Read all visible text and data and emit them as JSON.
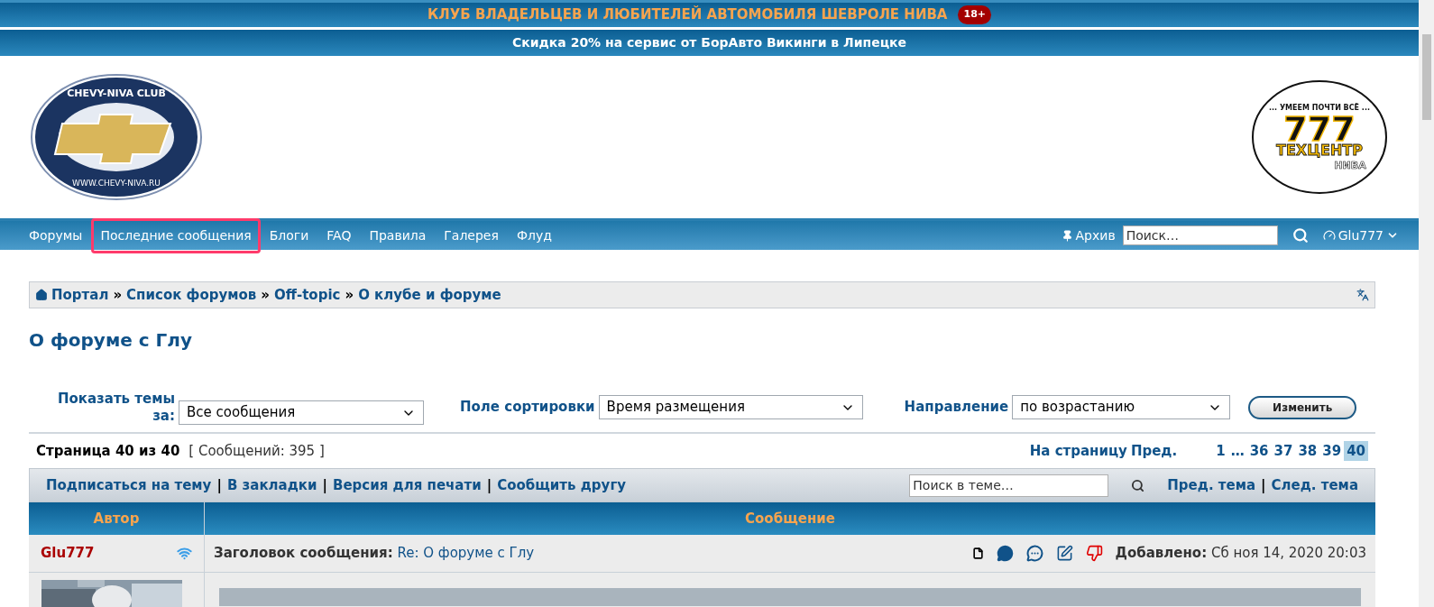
{
  "top_banner": {
    "title": "КЛУБ ВЛАДЕЛЬЦЕВ И ЛЮБИТЕЛЕЙ АВТОМОБИЛЯ ШЕВРОЛЕ НИВА",
    "badge": "18+"
  },
  "promo_banner": {
    "text": "Скидка 20% на сервис от БорАвто Викинги в Липецке"
  },
  "header": {
    "logo_left": {
      "top_text": "CHEVY-NIVA CLUB",
      "bottom_text": "WWW.CHEVY-NIVA.RU"
    },
    "logo_right": {
      "tagline": "... УМЕЕМ ПОЧТИ ВСЁ ...",
      "number": "777",
      "name": "ТЕХЦЕНТР",
      "sub": "НИВА"
    }
  },
  "nav": {
    "items": [
      {
        "label": "Форумы",
        "highlighted": false
      },
      {
        "label": "Последние сообщения",
        "highlighted": true
      },
      {
        "label": "Блоги",
        "highlighted": false
      },
      {
        "label": "FAQ",
        "highlighted": false
      },
      {
        "label": "Правила",
        "highlighted": false
      },
      {
        "label": "Галерея",
        "highlighted": false
      },
      {
        "label": "Флуд",
        "highlighted": false
      }
    ],
    "archive": "Архив",
    "search": {
      "placeholder": "Поиск…"
    },
    "user": "Glu777"
  },
  "breadcrumb": [
    {
      "label": "Портал"
    },
    {
      "separator": "»",
      "label": "Список форумов"
    },
    {
      "separator": "»",
      "label": "Off-topic"
    },
    {
      "separator": "»",
      "label": "О клубе и форуме"
    }
  ],
  "topic_title": "О форуме с Глу",
  "filters": [
    {
      "label": "Показать темы за:",
      "value": "Все сообщения"
    },
    {
      "label": "Поле сортировки",
      "value": "Время размещения"
    },
    {
      "label": "Направление",
      "value": "по возрастанию"
    }
  ],
  "submit": "Изменить",
  "page_info": {
    "page": "Страница 40 из 40",
    "count": "[ Сообщений: 395 ]"
  },
  "pagination": {
    "label": "На страницу",
    "prev": "Пред.",
    "pages": [
      {
        "label": "1",
        "selected": false
      },
      {
        "label": "…",
        "selected": false
      },
      {
        "label": "36",
        "selected": false
      },
      {
        "label": "37",
        "selected": false
      },
      {
        "label": "38",
        "selected": false
      },
      {
        "label": "39",
        "selected": false
      },
      {
        "label": "40",
        "selected": true
      }
    ]
  },
  "actions": [
    {
      "label": "Подписаться на тему"
    },
    {
      "separator": "|",
      "label": "В закладки"
    },
    {
      "separator": "|",
      "label": "Версия для печати"
    },
    {
      "separator": "|",
      "label": "Сообщить другу"
    }
  ],
  "topic_search": {
    "placeholder": "Поиск в теме…"
  },
  "topic_nav": [
    {
      "label": "Пред. тема"
    },
    {
      "separator": "|",
      "label": "След. тема"
    }
  ],
  "table": {
    "columns": [
      "Автор",
      "Сообщение"
    ]
  },
  "post": {
    "author": "Glu777",
    "subject_label": "Заголовок сообщения:",
    "subject": "Re: О форуме с Глу",
    "posted_label": "Добавлено:",
    "posted": "Сб ноя 14, 2020 20:03"
  }
}
